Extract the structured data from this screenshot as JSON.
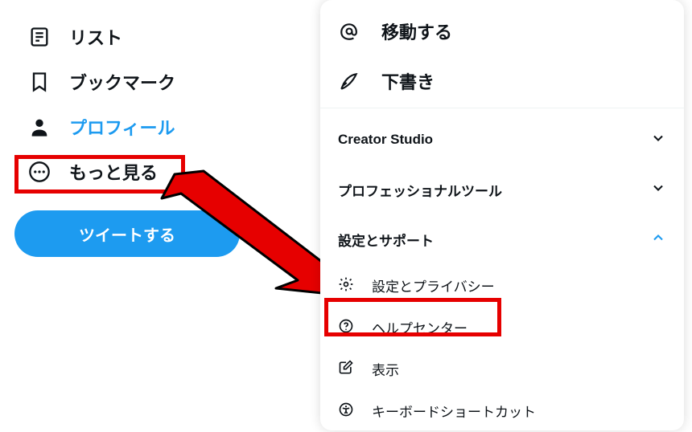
{
  "nav": {
    "lists": "リスト",
    "bookmarks": "ブックマーク",
    "profile": "プロフィール",
    "more": "もっと見る",
    "tweet": "ツイートする"
  },
  "panel": {
    "move": "移動する",
    "drafts": "下書き",
    "creator_studio": "Creator Studio",
    "pro_tools": "プロフェッショナルツール",
    "settings_support": "設定とサポート",
    "settings_privacy": "設定とプライバシー",
    "help_center": "ヘルプセンター",
    "display": "表示",
    "keyboard_shortcuts": "キーボードショートカット"
  },
  "colors": {
    "highlight": "#e60000",
    "accent": "#1d9bf0"
  }
}
